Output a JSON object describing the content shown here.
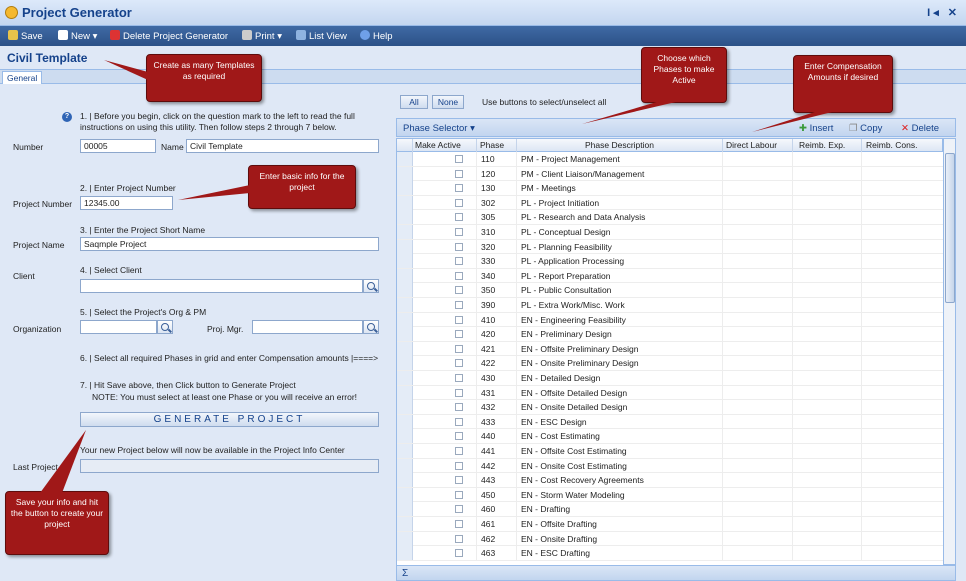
{
  "app": {
    "title": "Project Generator",
    "controls": "I◂ ✕"
  },
  "toolbar": {
    "save": "Save",
    "new": "New",
    "delete": "Delete Project Generator",
    "print": "Print",
    "list_view": "List View",
    "help": "Help",
    "dropdown": "▾"
  },
  "header": {
    "title": "Civil Template"
  },
  "tabs": [
    {
      "label": "General"
    }
  ],
  "form": {
    "help_mark": "?",
    "step1": "1. | Before you begin, click on the question mark to the left to read the full",
    "step1b": "instructions on using this utility. Then follow steps 2 through 7 below.",
    "number_label": "Number",
    "number_value": "00005",
    "name_label": "Name",
    "name_value": "Civil Template",
    "step2": "2. | Enter Project Number",
    "project_number_label": "Project Number",
    "project_number_value": "12345.00",
    "step3": "3. | Enter the Project Short Name",
    "project_name_label": "Project Name",
    "project_name_value": "Saqmple Project",
    "step4": "4. | Select Client",
    "client_label": "Client",
    "client_value": "",
    "step5": "5. | Select the Project's Org & PM",
    "org_label": "Organization",
    "org_value": "",
    "pm_label": "Proj. Mgr.",
    "pm_value": "",
    "step6": "6. | Select all required Phases in grid and enter Compensation amounts |====>",
    "step7": "7. | Hit Save above, then Click button to Generate Project",
    "note": "NOTE: You must select at least one Phase or you will receive an error!",
    "generate_label": "GENERATE PROJECT",
    "available_text": "Your new Project below will now be available in the Project Info Center",
    "last_project_label": "Last Project",
    "last_project_value": ""
  },
  "grid": {
    "all_label": "All",
    "none_label": "None",
    "select_hint": "Use buttons to select/unselect all",
    "title": "Phase Selector",
    "title_arrow": "▾",
    "insert": "Insert",
    "copy": "Copy",
    "delete": "Delete",
    "columns": [
      "Make Active",
      "Phase",
      "Phase Description",
      "Direct Labour",
      "Reimb. Exp.",
      "Reimb. Cons."
    ],
    "footer_sigma": "Σ",
    "rows": [
      {
        "phase": "110",
        "desc": "PM - Project Management"
      },
      {
        "phase": "120",
        "desc": "PM - Client Liaison/Management"
      },
      {
        "phase": "130",
        "desc": "PM - Meetings"
      },
      {
        "phase": "302",
        "desc": "PL - Project Initiation"
      },
      {
        "phase": "305",
        "desc": "PL - Research and Data Analysis"
      },
      {
        "phase": "310",
        "desc": "PL - Conceptual Design"
      },
      {
        "phase": "320",
        "desc": "PL - Planning Feasibility"
      },
      {
        "phase": "330",
        "desc": "PL - Application Processing"
      },
      {
        "phase": "340",
        "desc": "PL - Report Preparation"
      },
      {
        "phase": "350",
        "desc": "PL - Public Consultation"
      },
      {
        "phase": "390",
        "desc": "PL - Extra Work/Misc. Work"
      },
      {
        "phase": "410",
        "desc": "EN - Engineering Feasibility"
      },
      {
        "phase": "420",
        "desc": "EN - Preliminary Design"
      },
      {
        "phase": "421",
        "desc": "EN - Offsite Preliminary Design"
      },
      {
        "phase": "422",
        "desc": "EN - Onsite Preliminary Design"
      },
      {
        "phase": "430",
        "desc": "EN - Detailed Design"
      },
      {
        "phase": "431",
        "desc": "EN - Offsite Detailed Design"
      },
      {
        "phase": "432",
        "desc": "EN - Onsite Detailed Design"
      },
      {
        "phase": "433",
        "desc": "EN - ESC Design"
      },
      {
        "phase": "440",
        "desc": "EN - Cost Estimating"
      },
      {
        "phase": "441",
        "desc": "EN - Offsite Cost Estimating"
      },
      {
        "phase": "442",
        "desc": "EN - Onsite Cost Estimating"
      },
      {
        "phase": "443",
        "desc": "EN - Cost Recovery Agreements"
      },
      {
        "phase": "450",
        "desc": "EN - Storm Water Modeling"
      },
      {
        "phase": "460",
        "desc": "EN - Drafting"
      },
      {
        "phase": "461",
        "desc": "EN - Offsite Drafting"
      },
      {
        "phase": "462",
        "desc": "EN - Onsite Drafting"
      },
      {
        "phase": "463",
        "desc": "EN - ESC Drafting"
      }
    ]
  },
  "callouts": {
    "templates": "Create as many Templates as required",
    "basic_info": "Enter basic info for the project",
    "phases": "Choose which Phases to make Active",
    "compensation": "Enter Compensation Amounts if desired",
    "save": "Save your info and hit the button to create your project"
  },
  "colors": {
    "callout": "#a01818",
    "toolbar": "#2c5187",
    "accent": "#15428b"
  }
}
